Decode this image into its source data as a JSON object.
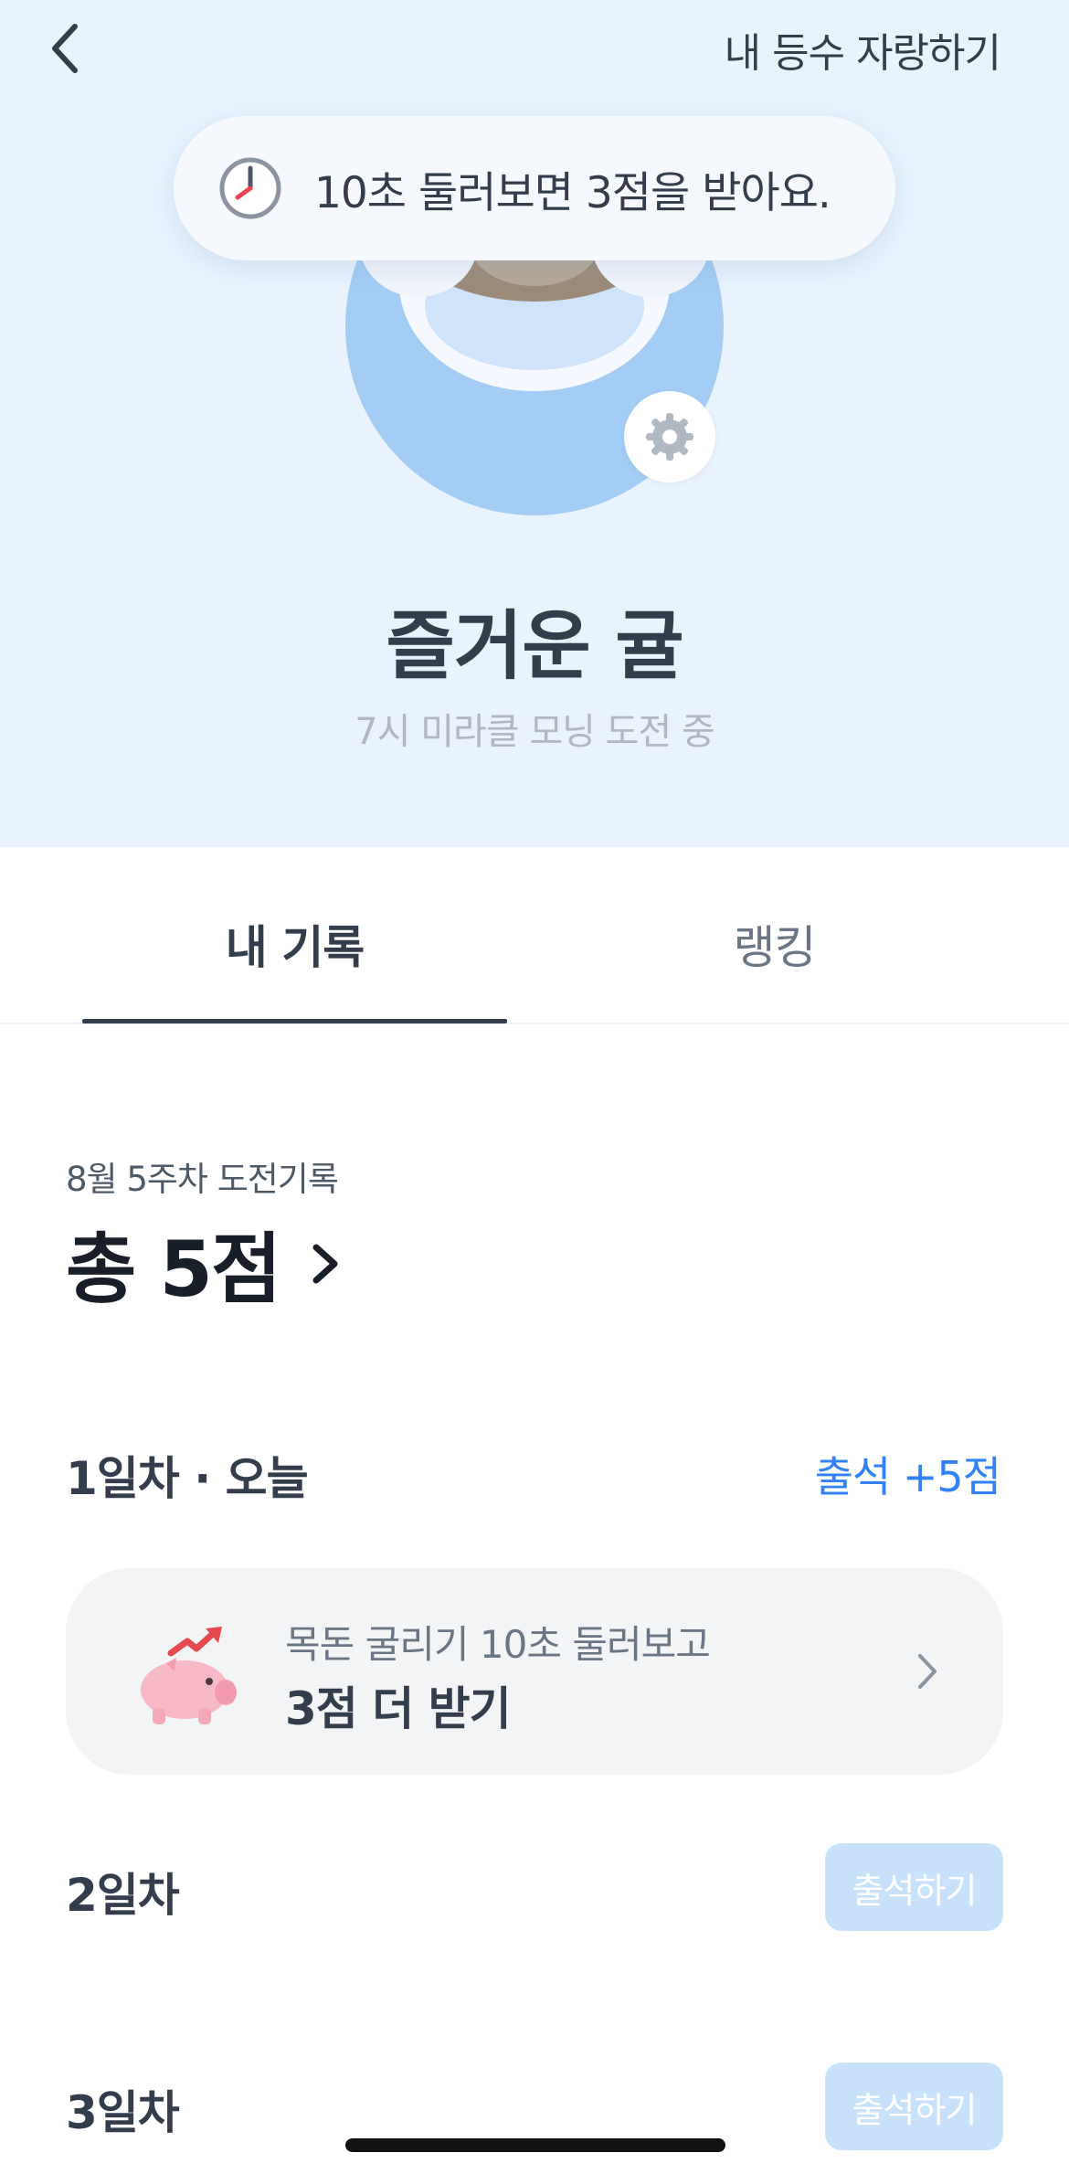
{
  "header": {
    "back_icon": "chevron-left-icon",
    "brag_label": "내 등수 자랑하기"
  },
  "toast": {
    "icon": "clock-icon",
    "text": "10초 둘러보면 3점을 받아요."
  },
  "profile": {
    "avatar": "otter-character",
    "settings_icon": "gear-icon",
    "nickname": "즐거운 귤",
    "status": "7시 미라클 모닝 도전 중"
  },
  "tabs": [
    {
      "label": "내 기록",
      "active": true
    },
    {
      "label": "랭킹",
      "active": false
    }
  ],
  "summary": {
    "week_label": "8월 5주차 도전기록",
    "total_label": "총 5점",
    "chevron_icon": "chevron-right-icon"
  },
  "days": [
    {
      "title": "1일차 · 오늘",
      "earned_label": "출석 +5점",
      "bonus_card": {
        "icon": "piggy-bank-icon",
        "subtitle": "목돈 굴리기 10초 둘러보고",
        "title": "3점 더 받기"
      }
    },
    {
      "title": "2일차",
      "button_label": "출석하기"
    },
    {
      "title": "3일차",
      "button_label": "출석하기"
    }
  ],
  "colors": {
    "hero_background": "#e8f3fe",
    "accent_blue": "#3182f6",
    "disabled_button": "#c9e2fc",
    "avatar_circle": "#a3cdf4"
  }
}
